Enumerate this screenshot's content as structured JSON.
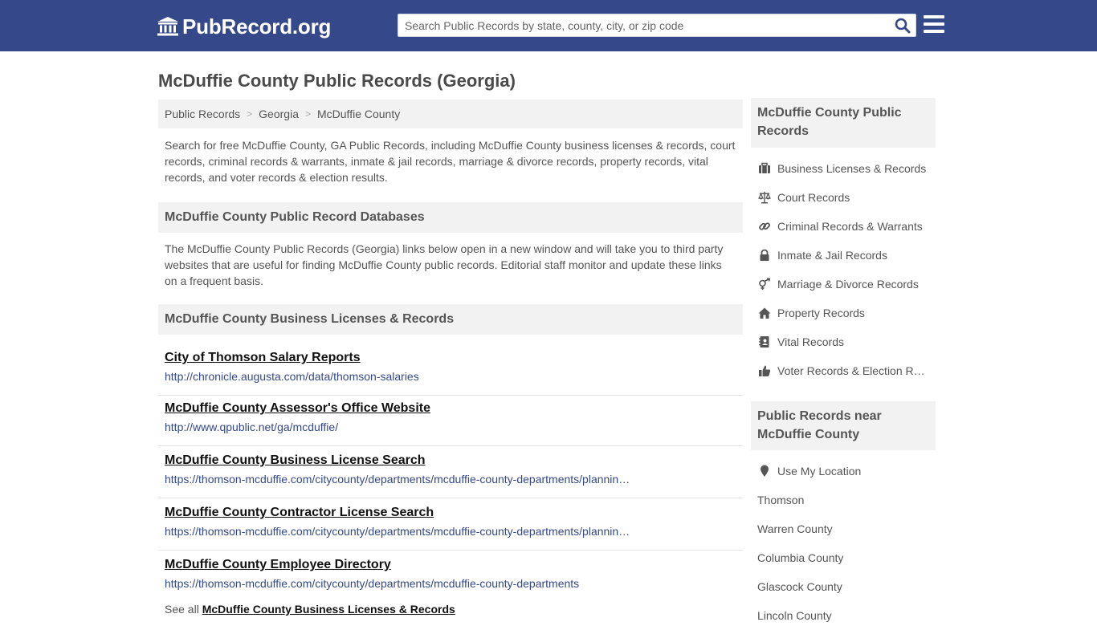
{
  "header": {
    "logo_text": "PubRecord.org",
    "search_placeholder": "Search Public Records by state, county, city, or zip code"
  },
  "page_title": "McDuffie County Public Records (Georgia)",
  "breadcrumb": [
    "Public Records",
    "Georgia",
    "McDuffie County"
  ],
  "intro": "Search for free McDuffie County, GA Public Records, including McDuffie County business licenses & records, court records, criminal records & warrants, inmate & jail records, marriage & divorce records, property records, vital records, and voter records & election results.",
  "databases_heading": "McDuffie County Public Record Databases",
  "databases_desc": "The McDuffie County Public Records (Georgia) links below open in a new window and will take you to third party websites that are useful for finding McDuffie County public records. Editorial staff monitor and update these links on a frequent basis.",
  "business_heading": "McDuffie County Business Licenses & Records",
  "records": [
    {
      "title": "City of Thomson Salary Reports",
      "url": "http://chronicle.augusta.com/data/thomson-salaries"
    },
    {
      "title": "McDuffie County Assessor's Office Website",
      "url": "http://www.qpublic.net/ga/mcduffie/"
    },
    {
      "title": "McDuffie County Business License Search",
      "url": "https://thomson-mcduffie.com/citycounty/departments/mcduffie-county-departments/planning-and-zoning"
    },
    {
      "title": "McDuffie County Contractor License Search",
      "url": "https://thomson-mcduffie.com/citycounty/departments/mcduffie-county-departments/planning-and-zoning"
    },
    {
      "title": "McDuffie County Employee Directory",
      "url": "https://thomson-mcduffie.com/citycounty/departments/mcduffie-county-departments"
    }
  ],
  "see_all_prefix": "See all",
  "see_all_link": "McDuffie County Business Licenses & Records",
  "sidebar": {
    "heading1": "McDuffie County Public Records",
    "categories": [
      {
        "label": "Business Licenses & Records",
        "icon": "briefcase-icon"
      },
      {
        "label": "Court Records",
        "icon": "scales-icon"
      },
      {
        "label": "Criminal Records & Warrants",
        "icon": "link-icon"
      },
      {
        "label": "Inmate & Jail Records",
        "icon": "lock-icon"
      },
      {
        "label": "Marriage & Divorce Records",
        "icon": "gender-icon"
      },
      {
        "label": "Property Records",
        "icon": "home-icon"
      },
      {
        "label": "Vital Records",
        "icon": "contact-book-icon"
      },
      {
        "label": "Voter Records & Election Results",
        "icon": "thumbs-up-icon"
      }
    ],
    "heading2": "Public Records near McDuffie County",
    "nearby": [
      {
        "label": "Use My Location",
        "icon": "map-marker-icon"
      },
      {
        "label": "Thomson"
      },
      {
        "label": "Warren County"
      },
      {
        "label": "Columbia County"
      },
      {
        "label": "Glascock County"
      },
      {
        "label": "Lincoln County"
      }
    ]
  },
  "colors": {
    "header_bg": "#35498a",
    "link_url": "#35498a",
    "panel_bg": "#f2f2f2"
  }
}
